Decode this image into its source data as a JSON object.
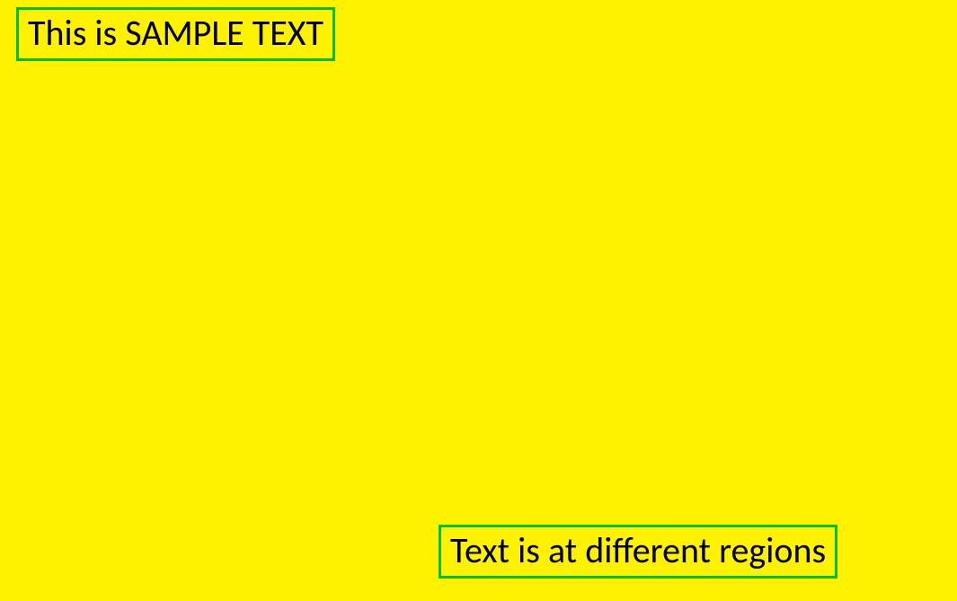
{
  "boxes": {
    "top_left": {
      "text": "This is SAMPLE TEXT"
    },
    "bottom_right": {
      "text": "Text is at different regions"
    }
  },
  "colors": {
    "background": "#FFF200",
    "border": "#00C000",
    "text": "#000000"
  }
}
